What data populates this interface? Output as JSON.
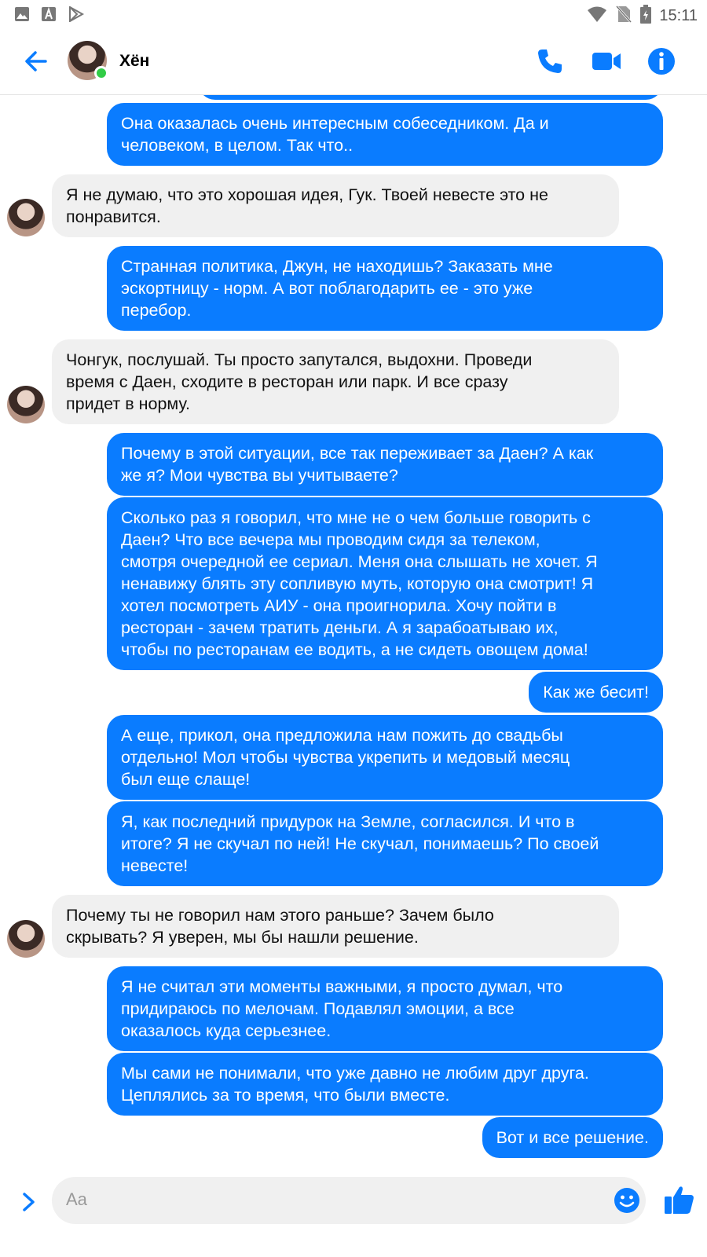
{
  "status_bar": {
    "time": "15:11"
  },
  "header": {
    "contact_name": "Хён"
  },
  "messages": [
    {
      "dir": "out",
      "text": "Она оказалась очень интересным собеседником. Да и\nчеловеком, в целом. Так что.."
    },
    {
      "dir": "in",
      "text": "Я не думаю, что это хорошая идея, Гук. Твоей невесте это не\nпонравится."
    },
    {
      "dir": "out",
      "text": "Странная политика, Джун, не находишь? Заказать мне\nэскортницу - норм. А вот поблагодарить ее - это уже\nперебор."
    },
    {
      "dir": "in",
      "text": "Чонгук, послушай. Ты просто запутался, выдохни. Проведи\nвремя с Даен, сходите в ресторан или парк. И все сразу\nпридет в норму."
    },
    {
      "dir": "out",
      "text": "Почему в этой ситуации, все так переживает за Даен? А как\nже я? Мои чувства вы учитываете?"
    },
    {
      "dir": "out",
      "text": "Сколько раз я говорил, что мне не о чем больше говорить с\nДаен? Что все вечера мы проводим сидя за телеком,\nсмотря очередной ее сериал. Меня она слышать не хочет. Я\nненавижу блять эту сопливую муть, которую она смотрит! Я\nхотел посмотреть АИУ - она проигнорила. Хочу пойти в\nресторан - зачем тратить деньги. А я зарабоатываю их,\nчтобы по ресторанам ее водить, а не сидеть овощем дома!"
    },
    {
      "dir": "out",
      "text": "Как же бесит!"
    },
    {
      "dir": "out",
      "text": "А еще, прикол, она предложила нам пожить до свадьбы\nотдельно! Мол чтобы чувства укрепить и медовый месяц\nбыл еще слаще!"
    },
    {
      "dir": "out",
      "text": "Я, как последний придурок на Земле, согласился. И что в\nитоге? Я не скучал по ней! Не скучал, понимаешь? По своей\nневесте!"
    },
    {
      "dir": "in",
      "text": "Почему ты не говорил нам этого раньше? Зачем было\nскрывать? Я уверен, мы бы нашли решение."
    },
    {
      "dir": "out",
      "text": "Я не считал эти моменты важными, я просто думал, что\nпридираюсь по мелочам. Подавлял эмоции, а все\nоказалось куда серьезнее."
    },
    {
      "dir": "out",
      "text": "Мы сами не понимали, что уже давно не любим друг друга.\nЦеплялись за то время, что были вместе."
    },
    {
      "dir": "out",
      "text": "Вот и все решение."
    }
  ],
  "composer": {
    "placeholder": "Aa"
  },
  "colors": {
    "accent": "#0a7cff",
    "incoming_bubble": "#f0f0f0",
    "online": "#31cc46"
  },
  "icons": [
    "image-icon",
    "a-icon",
    "play-store-icon",
    "wifi-icon",
    "no-sim-icon",
    "battery-icon",
    "back-arrow-icon",
    "phone-icon",
    "video-icon",
    "info-icon",
    "chevron-right-icon",
    "emoji-icon",
    "thumbs-up-icon"
  ]
}
